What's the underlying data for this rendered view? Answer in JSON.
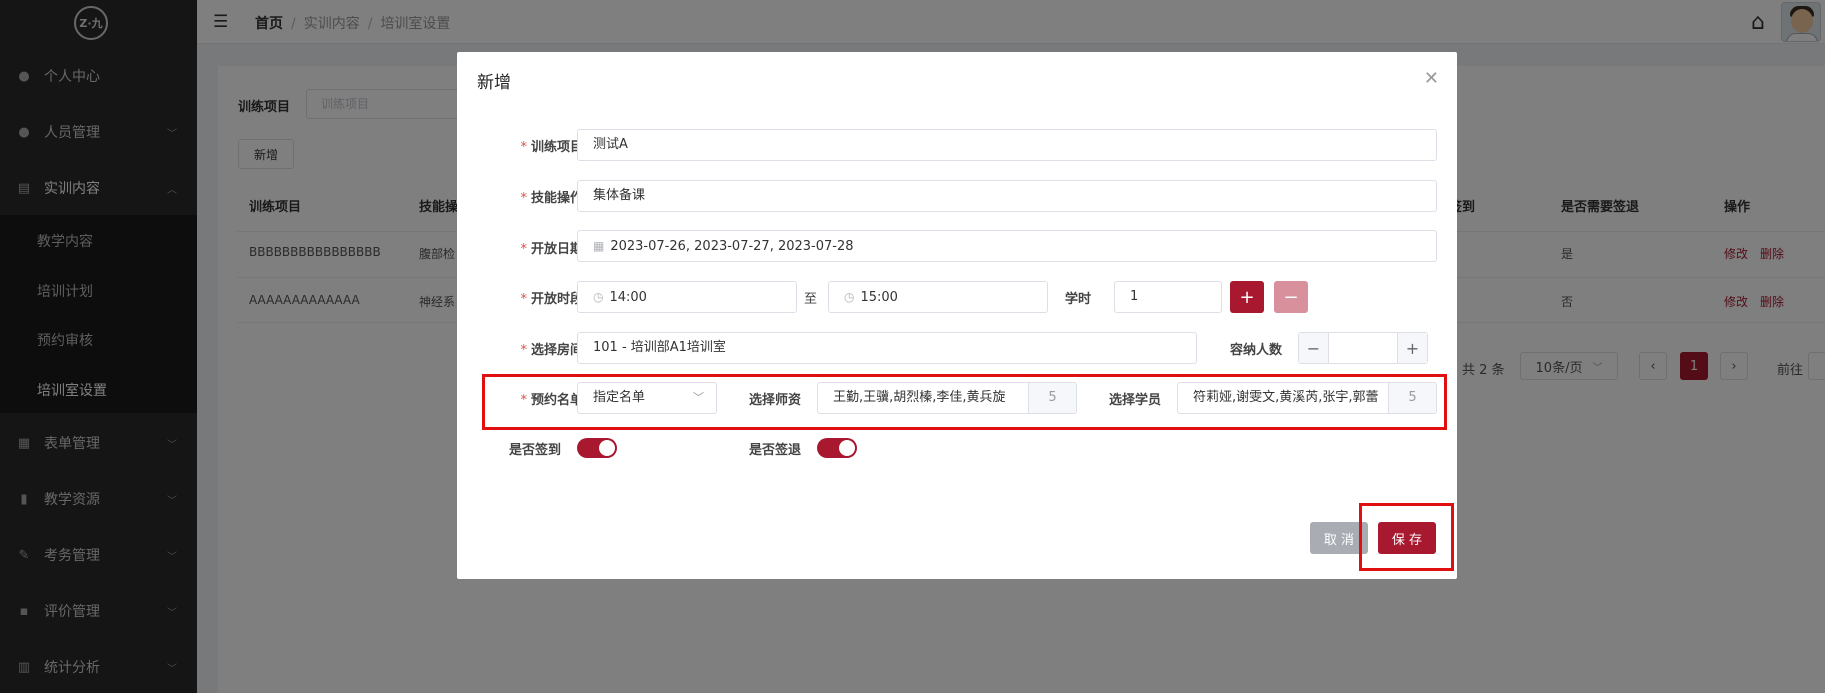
{
  "sidebar": {
    "logo_text": "Z·九",
    "items": [
      {
        "label": "个人中心",
        "icon": "user-icon"
      },
      {
        "label": "人员管理",
        "icon": "users-icon"
      },
      {
        "label": "实训内容",
        "icon": "book-icon"
      },
      {
        "label": "表单管理",
        "icon": "form-icon"
      },
      {
        "label": "教学资源",
        "icon": "resource-icon"
      },
      {
        "label": "考务管理",
        "icon": "exam-icon"
      },
      {
        "label": "评价管理",
        "icon": "rating-icon"
      },
      {
        "label": "统计分析",
        "icon": "chart-icon"
      }
    ],
    "submenu": [
      "教学内容",
      "培训计划",
      "预约审核",
      "培训室设置"
    ]
  },
  "header": {
    "breadcrumb": [
      "首页",
      "实训内容",
      "培训室设置"
    ]
  },
  "background": {
    "search_label": "训练项目",
    "search_placeholder": "训练项目",
    "add_button": "新增",
    "columns": [
      "训练项目",
      "技能操",
      "签到",
      "是否需要签退",
      "操作"
    ],
    "rows": [
      {
        "project": "BBBBBBBBBBBBBBBB",
        "skill": "腹部检",
        "signout": "是"
      },
      {
        "project": "AAAAAAAAAAAAA",
        "skill": "神经系",
        "signout": "否"
      }
    ],
    "edit": "修改",
    "delete": "删除",
    "pager": {
      "total": "共 2 条",
      "page_size": "10条/页",
      "current": "1",
      "goto": "前往"
    }
  },
  "modal": {
    "title": "新增",
    "fields": {
      "project": {
        "label": "训练项目",
        "value": "测试A"
      },
      "skill": {
        "label": "技能操作",
        "value": "集体备课"
      },
      "dates": {
        "label": "开放日期",
        "value": "2023-07-26, 2023-07-27, 2023-07-28"
      },
      "time": {
        "label": "开放时段",
        "start": "14:00",
        "sep": "至",
        "end": "15:00",
        "hours_label": "学时",
        "hours_value": "1"
      },
      "room": {
        "label": "选择房间",
        "value": "101 - 培训部A1培训室",
        "capacity_label": "容纳人数",
        "capacity_value": ""
      },
      "booking": {
        "label": "预约名单",
        "value": "指定名单"
      },
      "teachers": {
        "label": "选择师资",
        "value": "王勤,王骥,胡烈榛,李佳,黄兵旋",
        "count": "5"
      },
      "students": {
        "label": "选择学员",
        "value": "符莉娅,谢雯文,黄溪芮,张宇,郭蕾",
        "count": "5"
      },
      "signin": {
        "label": "是否签到"
      },
      "signout": {
        "label": "是否签退"
      }
    },
    "cancel": "取 消",
    "save": "保 存"
  },
  "colors": {
    "accent": "#a8182e",
    "highlight": "#e01010"
  }
}
